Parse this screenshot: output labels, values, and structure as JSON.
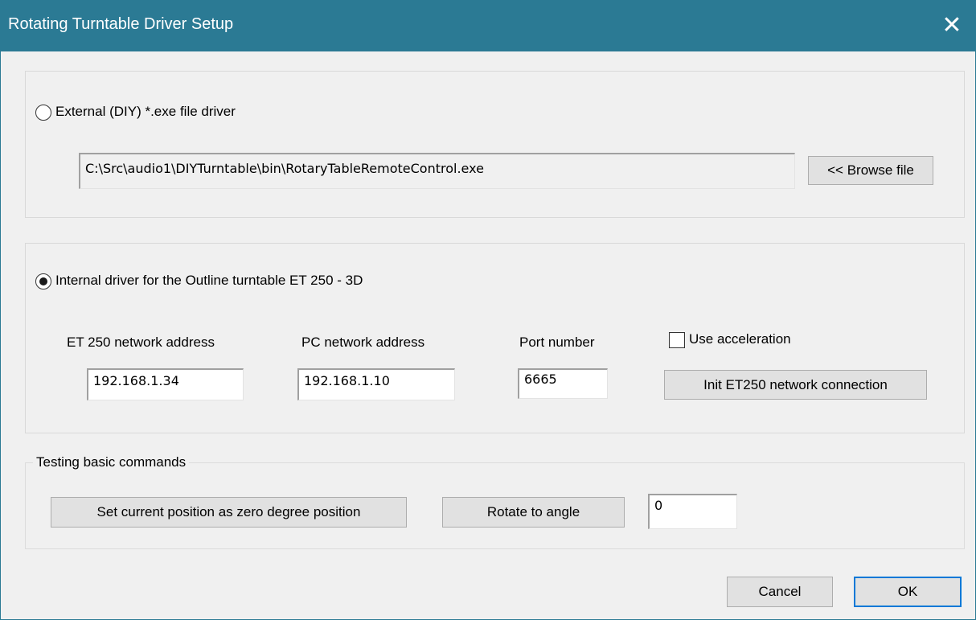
{
  "window": {
    "title": "Rotating Turntable Driver Setup",
    "close_glyph": "✕"
  },
  "external": {
    "radio_label": "External (DIY) *.exe file driver",
    "selected": false,
    "path_value": "C:\\Src\\audio1\\DIYTurntable\\bin\\RotaryTableRemoteControl.exe",
    "browse_label": "<< Browse file"
  },
  "internal": {
    "radio_label": "Internal driver for the Outline turntable ET 250 - 3D",
    "selected": true,
    "et250_label": "ET 250 network address",
    "et250_value": "192.168.1.34",
    "pc_label": "PC network address",
    "pc_value": "192.168.1.10",
    "port_label": "Port number",
    "port_value": "6665",
    "acceleration_label": "Use acceleration",
    "acceleration_checked": false,
    "init_button": "Init ET250 network connection"
  },
  "testing": {
    "caption": "Testing basic commands",
    "zero_button": "Set current position as zero degree position",
    "rotate_button": "Rotate to angle",
    "angle_value": "0"
  },
  "footer": {
    "cancel_label": "Cancel",
    "ok_label": "OK"
  },
  "colors": {
    "titlebar": "#2b7a94",
    "dialog_bg": "#f0f0f0",
    "button_bg": "#e1e1e1",
    "default_button_border": "#0078d7"
  },
  "icons": {
    "close": "close-icon",
    "radio_selected": "radio-selected-icon",
    "radio_unselected": "radio-unselected-icon",
    "checkbox_unchecked": "checkbox-icon"
  }
}
